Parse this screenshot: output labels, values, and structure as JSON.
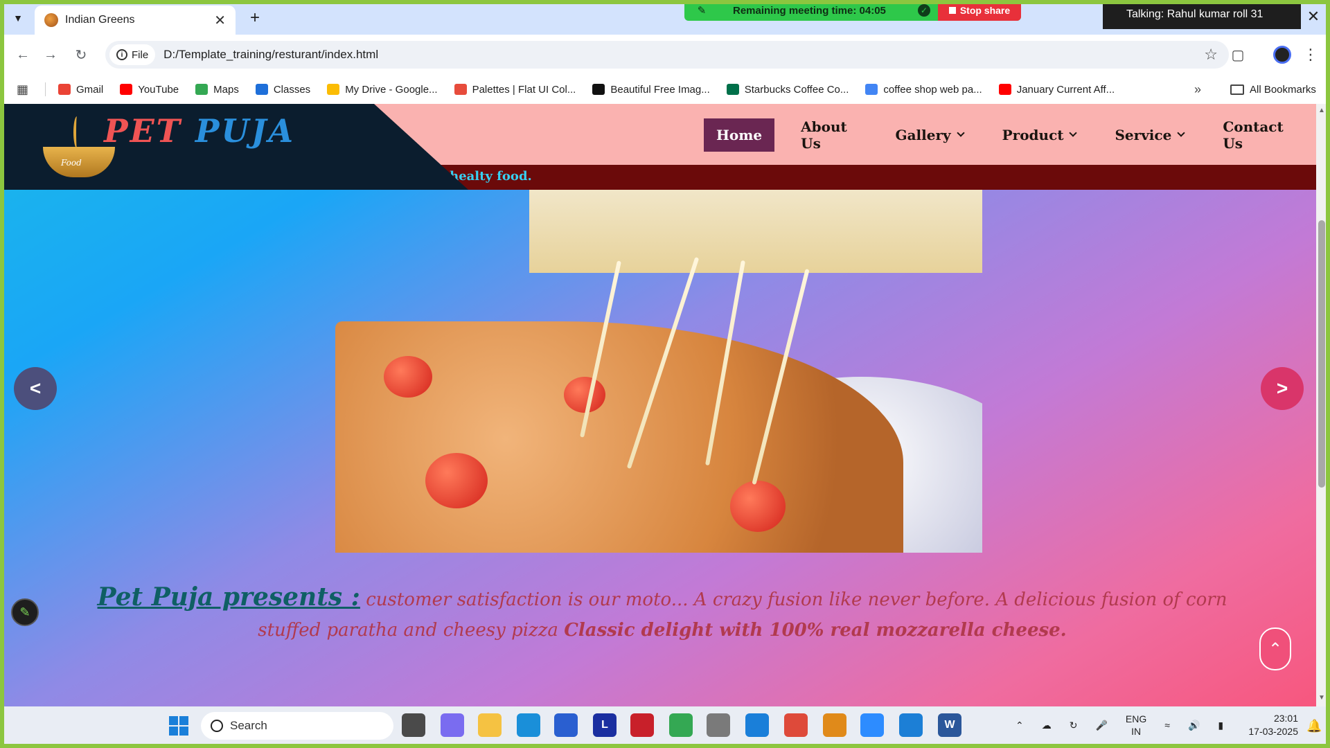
{
  "browser": {
    "tab": {
      "title": "Indian Greens",
      "favicon": "pumpkin-favicon"
    },
    "address": {
      "scheme_label": "File",
      "url": "D:/Template_training/resturant/index.html"
    },
    "bookmarks": [
      {
        "label": "Gmail",
        "icon": "gmail-icon",
        "color": "#ea4335"
      },
      {
        "label": "YouTube",
        "icon": "youtube-icon",
        "color": "#ff0000"
      },
      {
        "label": "Maps",
        "icon": "maps-icon",
        "color": "#34a853"
      },
      {
        "label": "Classes",
        "icon": "classroom-icon",
        "color": "#1e6fd9"
      },
      {
        "label": "My Drive - Google...",
        "icon": "drive-icon",
        "color": "#fbbc04"
      },
      {
        "label": "Palettes | Flat UI Col...",
        "icon": "palette-icon",
        "color": "#e74c3c"
      },
      {
        "label": "Beautiful Free Imag...",
        "icon": "unsplash-icon",
        "color": "#111111"
      },
      {
        "label": "Starbucks Coffee Co...",
        "icon": "starbucks-icon",
        "color": "#00704a"
      },
      {
        "label": "coffee shop web pa...",
        "icon": "search-icon",
        "color": "#4285f4"
      },
      {
        "label": "January Current Aff...",
        "icon": "youtube-icon",
        "color": "#ff0000"
      }
    ],
    "all_bookmarks": "All Bookmarks"
  },
  "meeting": {
    "remaining": "Remaining meeting time: 04:05",
    "stop_share": "Stop share",
    "talking": "Talking: Rahul kumar roll 31"
  },
  "site": {
    "logo": {
      "word1": "PET",
      "word2": "PUJA",
      "badge": "Food"
    },
    "nav": [
      {
        "label": "Home",
        "active": true,
        "dropdown": false
      },
      {
        "label": "About Us",
        "active": false,
        "dropdown": false
      },
      {
        "label": "Gallery",
        "active": false,
        "dropdown": true
      },
      {
        "label": "Product",
        "active": false,
        "dropdown": true
      },
      {
        "label": "Service",
        "active": false,
        "dropdown": true
      },
      {
        "label": "Contact Us",
        "active": false,
        "dropdown": false
      }
    ],
    "marquee": "l healty food.",
    "slider": {
      "prev": "<",
      "next": ">"
    },
    "presents": {
      "lead": "Pet Puja presents :",
      "body": " customer satisfaction is our moto... A crazy fusion like never before. A delicious fusion of corn stuffed paratha and cheesy pizza ",
      "bold": "Classic delight with 100% real mozzarella cheese."
    },
    "colors": {
      "header_bg": "#fab2b0",
      "nav_active": "#6a2652",
      "marquee_bg": "#6b0a0a",
      "logo_bg": "#0b1d2e"
    }
  },
  "taskbar": {
    "search_placeholder": "Search",
    "language": {
      "line1": "ENG",
      "line2": "IN"
    },
    "time": "23:01",
    "date": "17-03-2025"
  }
}
